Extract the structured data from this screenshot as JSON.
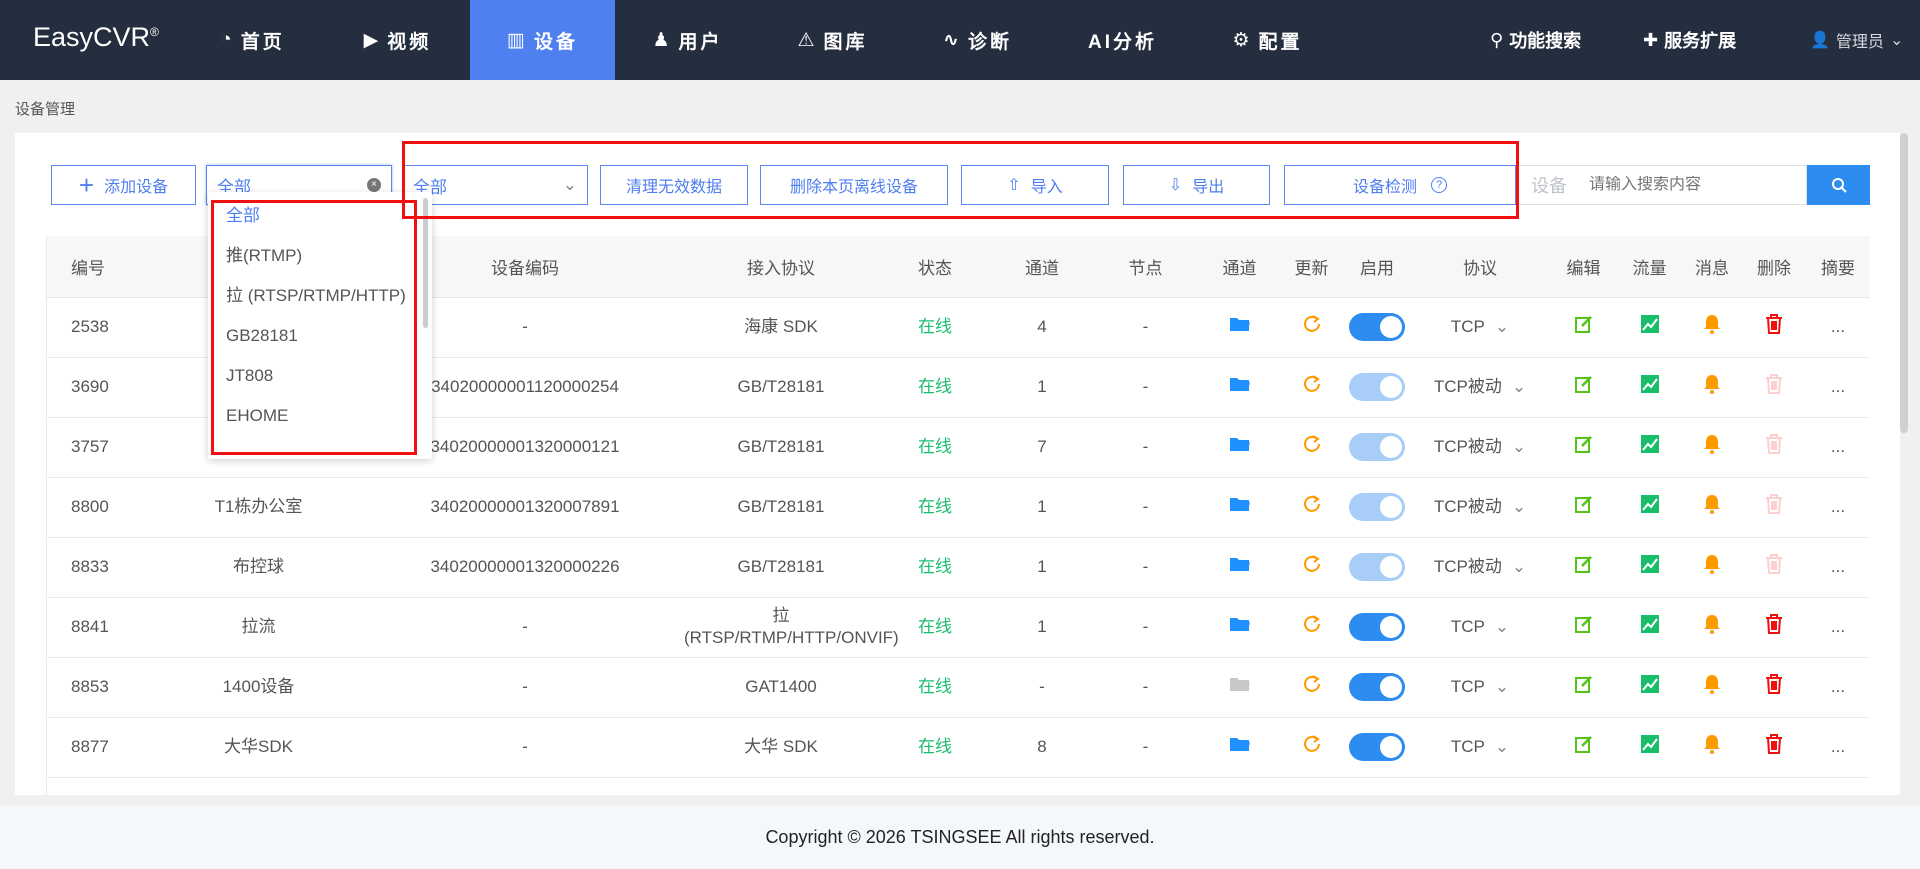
{
  "nav": {
    "logo": "EasyCVR",
    "reg": "®",
    "items": [
      {
        "label": "首页",
        "icon": "dashboard-icon"
      },
      {
        "label": "视频",
        "icon": "play-icon"
      },
      {
        "label": "设备",
        "icon": "device-icon"
      },
      {
        "label": "用户",
        "icon": "user-icon"
      },
      {
        "label": "图库",
        "icon": "alarm-icon"
      },
      {
        "label": "诊断",
        "icon": "pulse-icon"
      },
      {
        "label": "AI分析",
        "icon": ""
      },
      {
        "label": "配置",
        "icon": "gear-icon"
      }
    ],
    "search": "功能搜索",
    "extend": "服务扩展",
    "user": "管理员"
  },
  "breadcrumb": "设备管理",
  "toolbar": {
    "add": "添加设备",
    "filter1": "全部",
    "filter2": "全部",
    "clean": "清理无效数据",
    "delete_offline": "删除本页离线设备",
    "import": "导入",
    "export": "导出",
    "detect": "设备检测",
    "search_label": "设备",
    "search_placeholder": "请输入搜索内容"
  },
  "dropdown": [
    "全部",
    "推(RTMP)",
    "拉 (RTSP/RTMP/HTTP)",
    "GB28181",
    "JT808",
    "EHOME"
  ],
  "columns": [
    "编号",
    "",
    "设备编码",
    "接入协议",
    "状态",
    "通道",
    "节点",
    "通道",
    "更新",
    "启用",
    "协议",
    "编辑",
    "流量",
    "消息",
    "删除",
    "摘要"
  ],
  "rows": [
    {
      "id": "2538",
      "name": "",
      "code": "-",
      "access": "海康 SDK",
      "status": "在线",
      "channels": "4",
      "node": "-",
      "toggle": "on",
      "proto": "TCP",
      "del": true,
      "folder": true
    },
    {
      "id": "3690",
      "name": "",
      "code": "34020000001120000254",
      "access": "GB/T28181",
      "status": "在线",
      "channels": "1",
      "node": "-",
      "toggle": "dis",
      "proto": "TCP被动",
      "del": false,
      "folder": true
    },
    {
      "id": "3757",
      "name": "",
      "code": "34020000001320000121",
      "access": "GB/T28181",
      "status": "在线",
      "channels": "7",
      "node": "-",
      "toggle": "dis",
      "proto": "TCP被动",
      "del": false,
      "folder": true
    },
    {
      "id": "8800",
      "name": "T1栋办公室",
      "code": "34020000001320007891",
      "access": "GB/T28181",
      "status": "在线",
      "channels": "1",
      "node": "-",
      "toggle": "dis",
      "proto": "TCP被动",
      "del": false,
      "folder": true
    },
    {
      "id": "8833",
      "name": "布控球",
      "code": "34020000001320000226",
      "access": "GB/T28181",
      "status": "在线",
      "channels": "1",
      "node": "-",
      "toggle": "dis",
      "proto": "TCP被动",
      "del": false,
      "folder": true
    },
    {
      "id": "8841",
      "name": "拉流",
      "code": "-",
      "access": "拉 (RTSP/RTMP/HTTP/ONVIF)",
      "status": "在线",
      "channels": "1",
      "node": "-",
      "toggle": "on",
      "proto": "TCP",
      "del": true,
      "folder": true
    },
    {
      "id": "8853",
      "name": "1400设备",
      "code": "-",
      "access": "GAT1400",
      "status": "在线",
      "channels": "-",
      "node": "-",
      "toggle": "on",
      "proto": "TCP",
      "del": true,
      "folder": false
    },
    {
      "id": "8877",
      "name": "大华SDK",
      "code": "-",
      "access": "大华 SDK",
      "status": "在线",
      "channels": "8",
      "node": "-",
      "toggle": "on",
      "proto": "TCP",
      "del": true,
      "folder": true
    }
  ],
  "more": "...",
  "footer": "Copyright © 2026 TSINGSEE All rights reserved."
}
